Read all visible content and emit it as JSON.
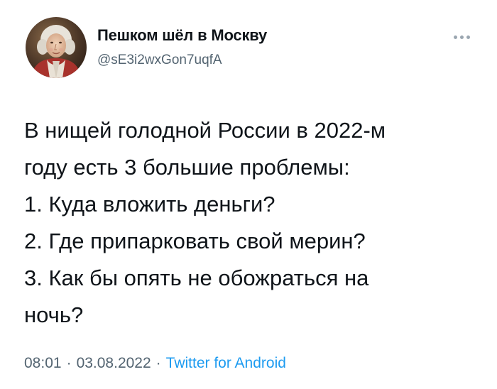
{
  "author": {
    "display_name": "Пешком шёл в Москву",
    "handle": "@sE3i2wxGon7uqfA",
    "avatar_icon": "portrait-avatar"
  },
  "more_icon": "ellipsis-icon",
  "tweet": {
    "lines": [
      "В нищей голодной России в 2022-м",
      "году есть 3 большие проблемы:",
      "1. Куда вложить деньги?",
      "2. Где припарковать свой мерин?",
      "3. Как бы опять не обожраться на",
      "ночь?"
    ]
  },
  "meta": {
    "time": "08:01",
    "separator": "·",
    "date": "03.08.2022",
    "source": "Twitter for Android"
  },
  "colors": {
    "text": "#0f1419",
    "secondary": "#536471",
    "link": "#1d9bf0"
  }
}
